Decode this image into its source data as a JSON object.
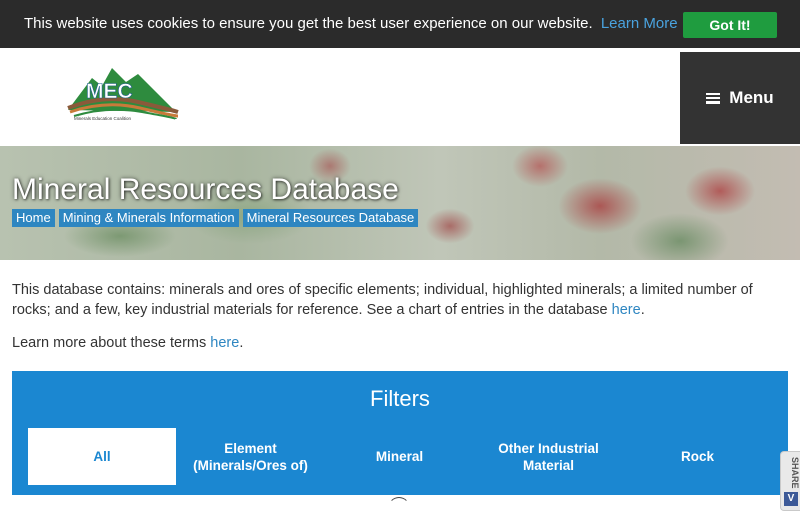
{
  "cookie_bar": {
    "message": "This website uses cookies to ensure you get the best user experience on our website.",
    "link_label": "Learn More",
    "button_label": "Got It!"
  },
  "header": {
    "logo_text": "MEC",
    "logo_tagline": "Minerals Education Coalition",
    "menu_label": "Menu"
  },
  "hero": {
    "title": "Mineral Resources Database",
    "breadcrumbs": [
      "Home",
      "Mining & Minerals Information",
      "Mineral Resources Database"
    ]
  },
  "content": {
    "intro_text": "This database contains: minerals and ores of specific elements; individual, highlighted minerals; a limited number of rocks; and a few, key industrial materials for reference.  See a chart of entries in the database ",
    "intro_link": "here",
    "intro_end": ".",
    "learn_text": "Learn more about these terms ",
    "learn_link": "here",
    "learn_end": "."
  },
  "filters": {
    "title": "Filters",
    "tabs": [
      {
        "label": "All",
        "active": true
      },
      {
        "label": "Element\n(Minerals/Ores of)",
        "active": false
      },
      {
        "label": "Mineral",
        "active": false
      },
      {
        "label": "Other Industrial\nMaterial",
        "active": false
      },
      {
        "label": "Rock",
        "active": false
      }
    ]
  },
  "share_widget": {
    "label": "SHARE",
    "icon": "V"
  },
  "colors": {
    "cookie_bg": "#2b2b2b",
    "accent_green": "#1f9c3f",
    "link_blue": "#2e86c1",
    "filters_blue": "#1b87d1",
    "menu_bg": "#333333"
  }
}
